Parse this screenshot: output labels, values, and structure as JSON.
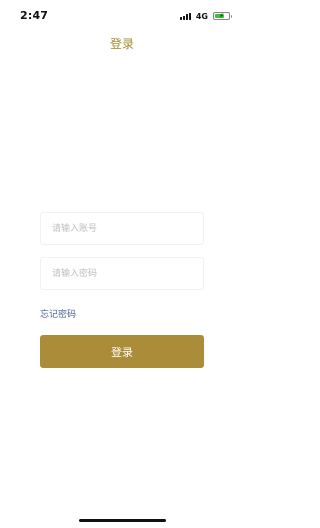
{
  "status_bar": {
    "time": "2:47",
    "network": "4G",
    "battery_level": 0.7,
    "battery_color": "#3ec13e"
  },
  "header": {
    "title": "登录"
  },
  "form": {
    "account_placeholder": "请输入账号",
    "password_placeholder": "请输入密码",
    "forgot_password": "忘记密码",
    "submit_label": "登录"
  },
  "colors": {
    "accent": "#ab8c38",
    "title": "#a68a30",
    "link": "#4a5f92"
  }
}
